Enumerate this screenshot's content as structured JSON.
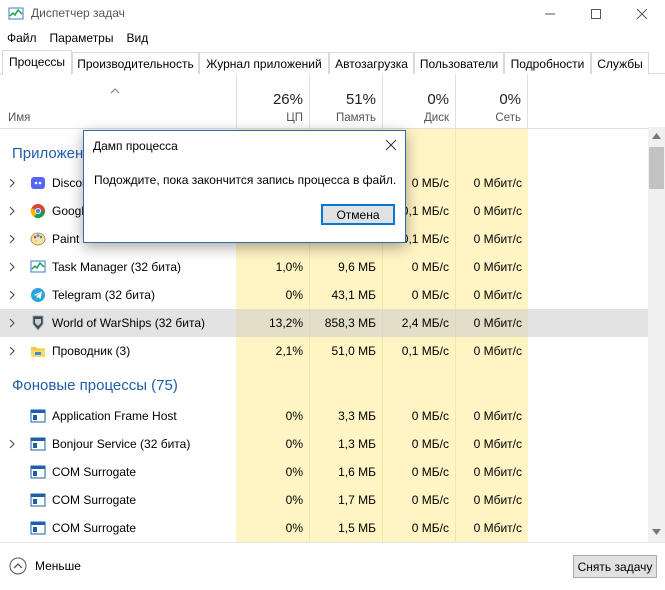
{
  "window": {
    "title": "Диспетчер задач",
    "controls": [
      "minimize",
      "maximize",
      "close"
    ]
  },
  "menu": [
    "Файл",
    "Параметры",
    "Вид"
  ],
  "tabs": [
    "Процессы",
    "Производительность",
    "Журнал приложений",
    "Автозагрузка",
    "Пользователи",
    "Подробности",
    "Службы"
  ],
  "active_tab": "Процессы",
  "columns": {
    "name": "Имя",
    "cpu": {
      "pct": "26%",
      "label": "ЦП"
    },
    "memory": {
      "pct": "51%",
      "label": "Память"
    },
    "disk": {
      "pct": "0%",
      "label": "Диск"
    },
    "network": {
      "pct": "0%",
      "label": "Сеть"
    }
  },
  "sections": {
    "apps": "Приложен",
    "background": "Фоновые процессы (75)"
  },
  "rows": [
    {
      "name": "Discor",
      "cpu": "",
      "mem": "",
      "disk": "0 МБ/с",
      "net": "0 Мбит/с",
      "icon": "discord-icon",
      "expand": true
    },
    {
      "name": "Googl",
      "cpu": "",
      "mem": "",
      "disk": "0,1 МБ/с",
      "net": "0 Мбит/с",
      "icon": "chrome-icon",
      "expand": true
    },
    {
      "name": "Paint",
      "cpu": "",
      "mem": "",
      "disk": "0,1 МБ/с",
      "net": "0 Мбит/с",
      "icon": "paint-icon",
      "expand": true
    },
    {
      "name": "Task Manager (32 бита)",
      "cpu": "1,0%",
      "mem": "9,6 МБ",
      "disk": "0 МБ/с",
      "net": "0 Мбит/с",
      "icon": "task-manager-icon",
      "expand": true
    },
    {
      "name": "Telegram (32 бита)",
      "cpu": "0%",
      "mem": "43,1 МБ",
      "disk": "0 МБ/с",
      "net": "0 Мбит/с",
      "icon": "telegram-icon",
      "expand": true
    },
    {
      "name": "World of WarShips (32 бита)",
      "cpu": "13,2%",
      "mem": "858,3 МБ",
      "disk": "2,4 МБ/с",
      "net": "0 Мбит/с",
      "icon": "warships-icon",
      "expand": true,
      "selected": true
    },
    {
      "name": "Проводник (3)",
      "cpu": "2,1%",
      "mem": "51,0 МБ",
      "disk": "0,1 МБ/с",
      "net": "0 Мбит/с",
      "icon": "explorer-icon",
      "expand": true
    }
  ],
  "bg_rows": [
    {
      "name": "Application Frame Host",
      "cpu": "0%",
      "mem": "3,3 МБ",
      "disk": "0 МБ/с",
      "net": "0 Мбит/с",
      "icon": "app-frame-icon",
      "expand": false
    },
    {
      "name": "Bonjour Service (32 бита)",
      "cpu": "0%",
      "mem": "1,3 МБ",
      "disk": "0 МБ/с",
      "net": "0 Мбит/с",
      "icon": "service-icon",
      "expand": true
    },
    {
      "name": "COM Surrogate",
      "cpu": "0%",
      "mem": "1,6 МБ",
      "disk": "0 МБ/с",
      "net": "0 Мбит/с",
      "icon": "service-icon",
      "expand": false
    },
    {
      "name": "COM Surrogate",
      "cpu": "0%",
      "mem": "1,7 МБ",
      "disk": "0 МБ/с",
      "net": "0 Мбит/с",
      "icon": "service-icon",
      "expand": false
    },
    {
      "name": "COM Surrogate",
      "cpu": "0%",
      "mem": "1,5 МБ",
      "disk": "0 МБ/с",
      "net": "0 Мбит/с",
      "icon": "service-icon",
      "expand": false
    }
  ],
  "footer": {
    "less": "Меньше",
    "end_task": "Снять задачу"
  },
  "dialog": {
    "title": "Дамп процесса",
    "message": "Подождите, пока закончится запись процесса в файл.",
    "cancel": "Отмена"
  },
  "colors": {
    "heat": "#fff4c4",
    "accent": "#1f5fa8",
    "selected_row": "#d9d9d9"
  }
}
